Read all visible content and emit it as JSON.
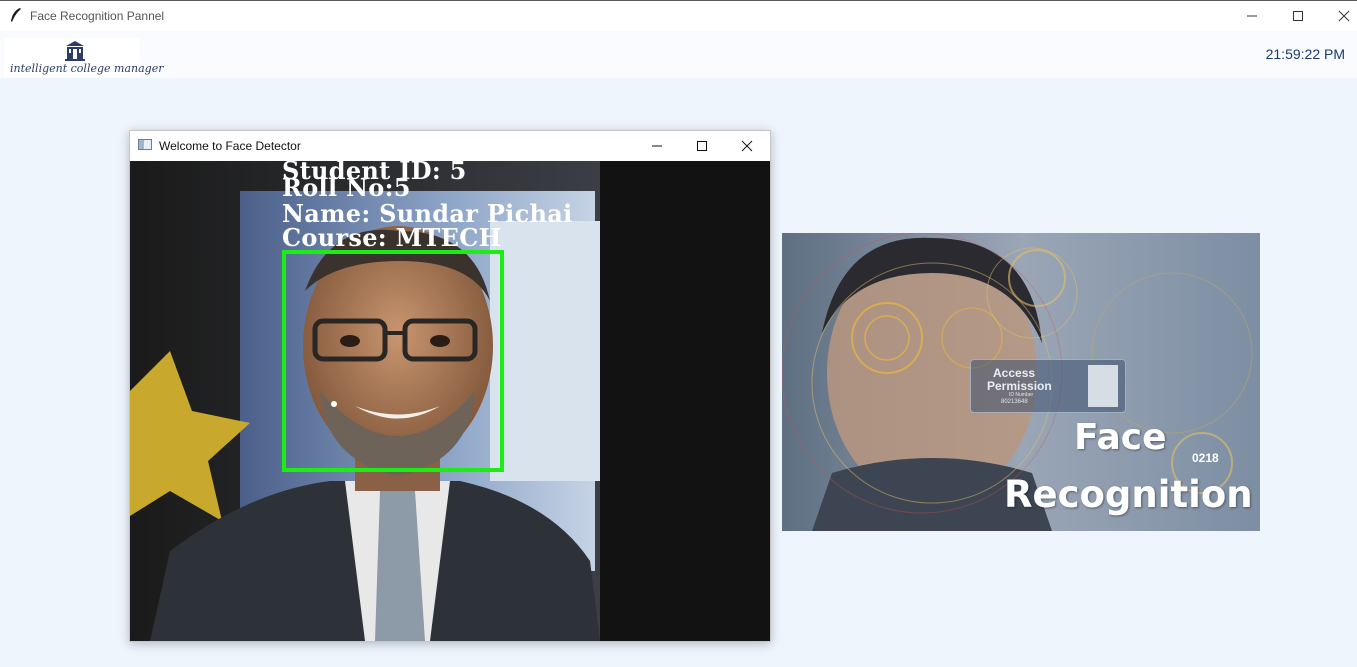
{
  "window": {
    "title": "Face Recognition Pannel"
  },
  "header": {
    "logo_text": "intelligent college manager",
    "clock": "21:59:22 PM"
  },
  "face_detector": {
    "title": "Welcome to Face Detector",
    "overlay": {
      "student_id": "Student ID: 5",
      "roll_no": "Roll No:5",
      "name": "Name: Sundar Pichai",
      "course": "Course: MTECH"
    },
    "box_color": "#1aee12"
  },
  "banner": {
    "access_line1": "Access",
    "access_line2": "Permission",
    "id_label": "ID Number",
    "id_number": "80213648",
    "code": "0218",
    "title_line1": "Face",
    "title_line2": "Recognition"
  },
  "icons": {
    "app": "feather-icon",
    "logo": "college-building-icon",
    "minimize": "minimize-icon",
    "maximize": "maximize-icon",
    "close": "close-icon"
  }
}
